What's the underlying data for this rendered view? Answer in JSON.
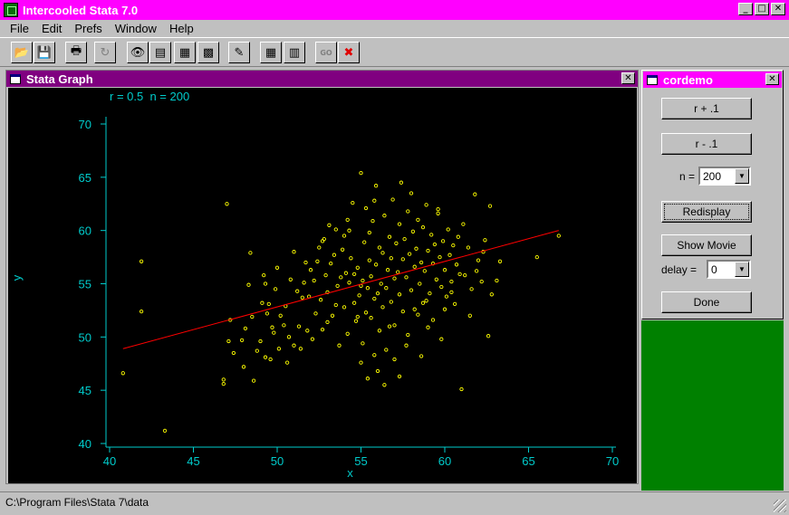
{
  "app": {
    "title": "Intercooled Stata 7.0"
  },
  "menu": [
    {
      "key": "file",
      "label": "File"
    },
    {
      "key": "edit",
      "label": "Edit"
    },
    {
      "key": "prefs",
      "label": "Prefs"
    },
    {
      "key": "window",
      "label": "Window"
    },
    {
      "key": "help",
      "label": "Help"
    }
  ],
  "toolbar": [
    {
      "name": "open-icon",
      "glyph": "📂"
    },
    {
      "name": "save-icon",
      "glyph": "💾"
    },
    {
      "name": "print-icon",
      "glyph": "🖶"
    },
    {
      "name": "refresh-icon",
      "glyph": "↻",
      "disabled": true
    },
    {
      "name": "viewer-icon",
      "glyph": "👁"
    },
    {
      "name": "results-icon",
      "glyph": "▤"
    },
    {
      "name": "graph-window-icon",
      "glyph": "▦"
    },
    {
      "name": "do-editor-icon",
      "glyph": "▩"
    },
    {
      "name": "log-icon",
      "glyph": "✎"
    },
    {
      "name": "data-editor-icon",
      "glyph": "▦"
    },
    {
      "name": "data-browser-icon",
      "glyph": "▥"
    },
    {
      "name": "go-icon",
      "glyph": "GO",
      "disabled": true
    },
    {
      "name": "break-icon",
      "glyph": "✖"
    }
  ],
  "graph_window": {
    "title": "Stata Graph"
  },
  "chart_data": {
    "type": "scatter",
    "title": "r = 0.5  n = 200",
    "xlabel": "x",
    "ylabel": "y",
    "xlim": [
      40,
      70
    ],
    "ylim": [
      40,
      70
    ],
    "xticks": [
      40,
      45,
      50,
      55,
      60,
      65,
      70
    ],
    "yticks": [
      40,
      45,
      50,
      55,
      60,
      65,
      70
    ],
    "grid": false,
    "colors": {
      "points": "#ffff00",
      "fit": "#ff0000",
      "axis": "#00cccc"
    },
    "fit_line": {
      "x": [
        40.8,
        66.8
      ],
      "y": [
        48.9,
        60.0
      ]
    },
    "points": [
      [
        40.8,
        46.6
      ],
      [
        41.9,
        57.1
      ],
      [
        41.9,
        52.4
      ],
      [
        43.3,
        41.2
      ],
      [
        47.0,
        62.5
      ],
      [
        46.8,
        46.0
      ],
      [
        46.8,
        45.6
      ],
      [
        47.1,
        49.6
      ],
      [
        47.2,
        51.6
      ],
      [
        47.9,
        49.7
      ],
      [
        48.1,
        50.8
      ],
      [
        48.3,
        54.9
      ],
      [
        48.4,
        57.9
      ],
      [
        48.5,
        51.9
      ],
      [
        48.6,
        45.9
      ],
      [
        48.8,
        48.7
      ],
      [
        49.0,
        49.6
      ],
      [
        49.1,
        53.2
      ],
      [
        49.2,
        55.8
      ],
      [
        49.3,
        48.1
      ],
      [
        49.4,
        52.2
      ],
      [
        49.5,
        53.1
      ],
      [
        49.6,
        47.9
      ],
      [
        49.8,
        50.4
      ],
      [
        49.9,
        54.5
      ],
      [
        50.1,
        48.9
      ],
      [
        50.2,
        52.0
      ],
      [
        50.4,
        51.1
      ],
      [
        50.6,
        47.6
      ],
      [
        50.7,
        50.0
      ],
      [
        50.8,
        55.4
      ],
      [
        51.0,
        49.2
      ],
      [
        51.2,
        54.3
      ],
      [
        51.3,
        51.0
      ],
      [
        51.4,
        48.9
      ],
      [
        51.6,
        55.1
      ],
      [
        51.7,
        57.0
      ],
      [
        51.8,
        50.6
      ],
      [
        51.9,
        53.8
      ],
      [
        52.1,
        49.8
      ],
      [
        52.2,
        55.3
      ],
      [
        52.3,
        52.2
      ],
      [
        52.4,
        57.1
      ],
      [
        52.5,
        58.4
      ],
      [
        52.6,
        53.5
      ],
      [
        52.7,
        50.7
      ],
      [
        52.8,
        59.2
      ],
      [
        52.9,
        55.8
      ],
      [
        53.0,
        54.2
      ],
      [
        53.1,
        60.5
      ],
      [
        53.2,
        56.9
      ],
      [
        53.3,
        52.0
      ],
      [
        53.4,
        57.7
      ],
      [
        53.5,
        60.1
      ],
      [
        53.6,
        54.8
      ],
      [
        53.7,
        49.2
      ],
      [
        53.8,
        55.6
      ],
      [
        53.9,
        58.2
      ],
      [
        54.0,
        52.8
      ],
      [
        54.1,
        56.0
      ],
      [
        54.2,
        61.0
      ],
      [
        54.2,
        50.3
      ],
      [
        54.3,
        55.1
      ],
      [
        54.4,
        57.4
      ],
      [
        54.5,
        62.6
      ],
      [
        54.6,
        53.2
      ],
      [
        54.6,
        55.9
      ],
      [
        54.7,
        51.5
      ],
      [
        54.8,
        56.5
      ],
      [
        54.9,
        53.9
      ],
      [
        55.0,
        54.8
      ],
      [
        55.0,
        65.4
      ],
      [
        55.1,
        49.4
      ],
      [
        55.1,
        55.3
      ],
      [
        55.2,
        58.9
      ],
      [
        55.3,
        52.3
      ],
      [
        55.3,
        62.1
      ],
      [
        55.4,
        46.1
      ],
      [
        55.4,
        54.6
      ],
      [
        55.5,
        57.2
      ],
      [
        55.5,
        59.8
      ],
      [
        55.6,
        51.8
      ],
      [
        55.6,
        55.7
      ],
      [
        55.7,
        60.9
      ],
      [
        55.8,
        53.6
      ],
      [
        55.8,
        48.3
      ],
      [
        55.9,
        56.8
      ],
      [
        55.9,
        64.2
      ],
      [
        56.0,
        54.1
      ],
      [
        56.1,
        58.4
      ],
      [
        56.1,
        50.6
      ],
      [
        56.2,
        55.0
      ],
      [
        56.3,
        57.9
      ],
      [
        56.3,
        52.8
      ],
      [
        56.4,
        61.4
      ],
      [
        56.5,
        54.6
      ],
      [
        56.5,
        48.8
      ],
      [
        56.6,
        56.3
      ],
      [
        56.7,
        59.4
      ],
      [
        56.8,
        53.3
      ],
      [
        56.8,
        57.4
      ],
      [
        56.9,
        62.9
      ],
      [
        57.0,
        55.5
      ],
      [
        57.0,
        51.1
      ],
      [
        57.1,
        58.8
      ],
      [
        57.2,
        56.1
      ],
      [
        57.3,
        60.6
      ],
      [
        57.3,
        54.0
      ],
      [
        57.4,
        64.5
      ],
      [
        57.5,
        57.3
      ],
      [
        57.5,
        52.4
      ],
      [
        57.6,
        59.2
      ],
      [
        57.7,
        55.6
      ],
      [
        57.8,
        61.8
      ],
      [
        57.8,
        50.2
      ],
      [
        57.9,
        57.8
      ],
      [
        58.0,
        54.4
      ],
      [
        58.1,
        59.9
      ],
      [
        58.2,
        56.6
      ],
      [
        58.2,
        52.6
      ],
      [
        58.3,
        58.3
      ],
      [
        58.4,
        61.0
      ],
      [
        58.5,
        55.0
      ],
      [
        58.6,
        57.0
      ],
      [
        58.7,
        53.2
      ],
      [
        58.7,
        60.3
      ],
      [
        58.8,
        56.2
      ],
      [
        58.9,
        62.4
      ],
      [
        59.0,
        58.1
      ],
      [
        59.1,
        54.1
      ],
      [
        59.2,
        59.6
      ],
      [
        59.3,
        56.9
      ],
      [
        59.3,
        51.6
      ],
      [
        59.4,
        58.7
      ],
      [
        59.5,
        55.4
      ],
      [
        59.6,
        61.6
      ],
      [
        59.7,
        57.5
      ],
      [
        59.8,
        54.7
      ],
      [
        59.9,
        59.0
      ],
      [
        60.0,
        56.3
      ],
      [
        60.1,
        53.8
      ],
      [
        60.2,
        60.1
      ],
      [
        60.3,
        57.7
      ],
      [
        60.4,
        55.2
      ],
      [
        60.5,
        58.6
      ],
      [
        60.6,
        53.1
      ],
      [
        60.7,
        56.8
      ],
      [
        60.8,
        59.4
      ],
      [
        60.9,
        55.9
      ],
      [
        61.0,
        45.1
      ],
      [
        61.1,
        60.6
      ],
      [
        61.2,
        55.8
      ],
      [
        61.4,
        58.4
      ],
      [
        61.6,
        54.5
      ],
      [
        61.8,
        63.4
      ],
      [
        62.0,
        57.2
      ],
      [
        62.2,
        55.2
      ],
      [
        62.4,
        59.1
      ],
      [
        62.6,
        50.1
      ],
      [
        62.7,
        62.3
      ],
      [
        62.8,
        54.0
      ],
      [
        63.1,
        55.3
      ],
      [
        63.3,
        57.1
      ],
      [
        65.5,
        57.5
      ],
      [
        66.8,
        59.5
      ],
      [
        50.5,
        52.9
      ],
      [
        51.5,
        53.7
      ],
      [
        52.0,
        56.3
      ],
      [
        53.0,
        51.4
      ],
      [
        54.0,
        59.5
      ],
      [
        55.0,
        47.6
      ],
      [
        56.0,
        46.8
      ],
      [
        57.0,
        47.9
      ],
      [
        57.7,
        49.2
      ],
      [
        58.4,
        52.1
      ],
      [
        59.0,
        50.9
      ],
      [
        60.0,
        52.6
      ],
      [
        61.5,
        52.0
      ],
      [
        49.7,
        50.9
      ],
      [
        48.0,
        47.2
      ],
      [
        47.4,
        48.5
      ],
      [
        53.5,
        53.0
      ],
      [
        54.8,
        51.9
      ],
      [
        56.7,
        51.0
      ],
      [
        58.9,
        53.4
      ],
      [
        60.4,
        54.2
      ],
      [
        61.9,
        56.2
      ],
      [
        62.3,
        58.0
      ],
      [
        59.6,
        62.0
      ],
      [
        58.0,
        63.5
      ],
      [
        55.8,
        62.8
      ],
      [
        54.3,
        60.0
      ],
      [
        52.7,
        59.0
      ],
      [
        51.0,
        58.0
      ],
      [
        50.0,
        56.5
      ],
      [
        49.3,
        55.0
      ],
      [
        56.4,
        45.5
      ],
      [
        57.3,
        46.3
      ],
      [
        58.6,
        48.2
      ],
      [
        59.8,
        49.8
      ]
    ]
  },
  "cordemo": {
    "title": "cordemo",
    "r_plus_label": "r + .1",
    "r_minus_label": "r - .1",
    "n_label": "n =",
    "n_value": "200",
    "redisplay_label": "Redisplay",
    "show_movie_label": "Show Movie",
    "delay_label": "delay =",
    "delay_value": "0",
    "done_label": "Done"
  },
  "status": {
    "path": "C:\\Program Files\\Stata 7\\data"
  }
}
